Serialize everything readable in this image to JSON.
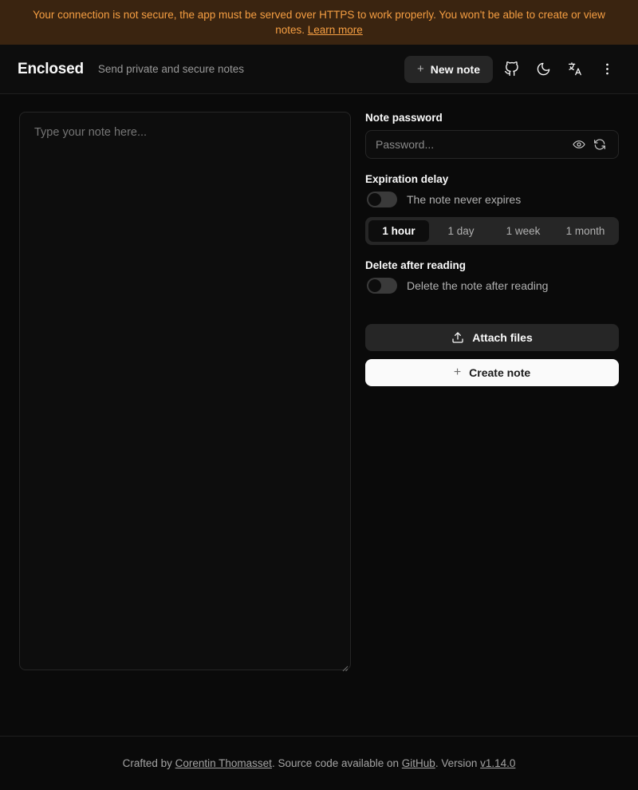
{
  "banner": {
    "text": "Your connection is not secure, the app must be served over HTTPS to work properly. You won't be able to create or view notes.",
    "link_label": "Learn more",
    "bg_color": "#3a2410",
    "text_color": "#f59e42"
  },
  "header": {
    "brand": "Enclosed",
    "tagline": "Send private and secure notes",
    "new_note_label": "New note",
    "new_note_icon": "plus-icon",
    "icons": [
      {
        "name": "github-icon"
      },
      {
        "name": "moon-icon"
      },
      {
        "name": "translate-icon"
      },
      {
        "name": "more-vertical-icon"
      }
    ]
  },
  "editor": {
    "placeholder": "Type your note here...",
    "value": ""
  },
  "sidebar": {
    "password": {
      "label": "Note password",
      "placeholder": "Password...",
      "value": "",
      "reveal_icon": "eye-icon",
      "regenerate_icon": "refresh-icon"
    },
    "expiration": {
      "label": "Expiration delay",
      "toggle_label": "The note never expires",
      "toggle_on": false,
      "options": [
        "1 hour",
        "1 day",
        "1 week",
        "1 month"
      ],
      "selected": "1 hour"
    },
    "delete_after_reading": {
      "label": "Delete after reading",
      "toggle_label": "Delete the note after reading",
      "toggle_on": false
    },
    "attach_label": "Attach files",
    "attach_icon": "upload-icon",
    "create_label": "Create note",
    "create_icon": "plus-icon"
  },
  "footer": {
    "prefix": "Crafted by ",
    "author": "Corentin Thomasset",
    "middle": ". Source code available on ",
    "source": "GitHub",
    "version_prefix": ". Version ",
    "version": "v1.14.0"
  }
}
